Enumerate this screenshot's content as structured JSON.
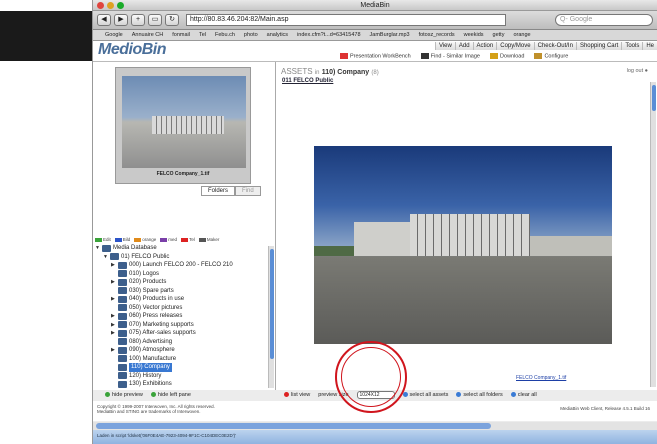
{
  "window": {
    "title": "MediaBin"
  },
  "nav": {
    "url": "http://80.83.46.204:82/Main.asp",
    "search_placeholder": "Google"
  },
  "bookmarks": [
    "Google",
    "Annuaire CH",
    "fonmail",
    "Tel",
    "Febu.ch",
    "photo",
    "analytics",
    "index.cfm?t...d=63415478",
    "JamBurglar.mp3",
    "fotosz_records",
    "weekids",
    "getty",
    "orange"
  ],
  "app": {
    "logo": "MedioBin",
    "menu": [
      "View",
      "Add",
      "Action",
      "Copy/Move",
      "Check-Out/In",
      "Shopping Cart",
      "Tools",
      "He"
    ],
    "tools": [
      "Presentation WorkBench",
      "Find - Similar Image",
      "Download",
      "Configure"
    ]
  },
  "left": {
    "preview_caption": "FELCO Company_1.tif",
    "tabs": [
      "Folders",
      "Find"
    ],
    "legend": [
      "Edit",
      "Bild",
      "orange",
      "med",
      "Tel",
      "Maker"
    ],
    "tree": [
      {
        "label": "Media Database",
        "indent": 0,
        "tri": "▼"
      },
      {
        "label": "01) FELCO Public",
        "indent": 1,
        "tri": "▼"
      },
      {
        "label": "000) Launch FELCO 200 - FELCO 210",
        "indent": 2,
        "tri": "▶"
      },
      {
        "label": "010) Logos",
        "indent": 2,
        "tri": ""
      },
      {
        "label": "020) Products",
        "indent": 2,
        "tri": "▶"
      },
      {
        "label": "030) Spare parts",
        "indent": 2,
        "tri": ""
      },
      {
        "label": "040) Products in use",
        "indent": 2,
        "tri": "▶"
      },
      {
        "label": "050) Vector pictures",
        "indent": 2,
        "tri": ""
      },
      {
        "label": "060) Press releases",
        "indent": 2,
        "tri": "▶"
      },
      {
        "label": "070) Marketing supports",
        "indent": 2,
        "tri": "▶"
      },
      {
        "label": "075) After-sales supports",
        "indent": 2,
        "tri": "▶"
      },
      {
        "label": "080) Advertising",
        "indent": 2,
        "tri": ""
      },
      {
        "label": "090) Atmosphere",
        "indent": 2,
        "tri": "▶"
      },
      {
        "label": "100) Manufacture",
        "indent": 2,
        "tri": ""
      },
      {
        "label": "110) Company",
        "indent": 2,
        "tri": "",
        "selected": true
      },
      {
        "label": "120) History",
        "indent": 2,
        "tri": ""
      },
      {
        "label": "130) Exhibitions",
        "indent": 2,
        "tri": ""
      }
    ],
    "footer": [
      "hide preview",
      "hide left pane"
    ]
  },
  "right": {
    "assets_prefix": "ASSETS",
    "assets_in": "in",
    "folder": "110) Company",
    "count": "(8)",
    "logout": "log out",
    "crumb": "011 FELCO Public",
    "image_link": "FELCO Company_1.tif",
    "footer": {
      "list_view": "list view",
      "preview_size_label": "preview size",
      "preview_size_value": "1024X12",
      "select_all_assets": "select all assets",
      "select_all_folders": "select all folders",
      "clear_all": "clear all"
    }
  },
  "copyright": {
    "line1": "Copyright © 1999-2007 Interwoven, Inc. All rights reserved.",
    "line2": "MediaBin and STING are trademarks of Interwoven.",
    "release": "MediaBin Web Client, Release 4.5.1 Build 16"
  },
  "status": "Laden in script 'ldsket('06F0E4AE-7923-4094-9F1C-C104DEC0E2D')'"
}
